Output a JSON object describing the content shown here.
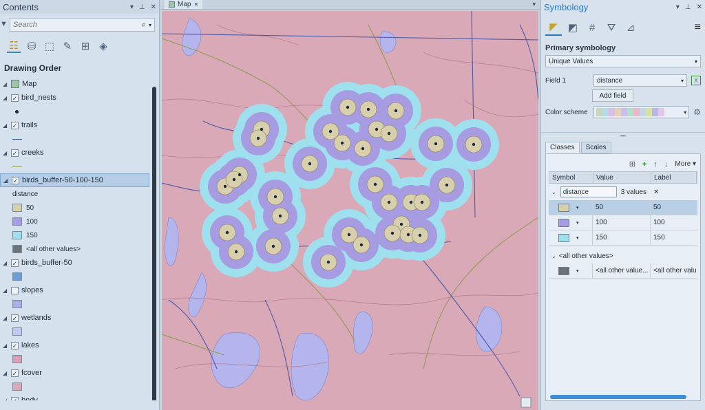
{
  "contents": {
    "title": "Contents",
    "search_placeholder": "Search",
    "drawing_order": "Drawing Order",
    "map_label": "Map",
    "layers": [
      {
        "name": "bird_nests",
        "checked": true
      },
      {
        "name": "trails",
        "checked": true
      },
      {
        "name": "creeks",
        "checked": true
      },
      {
        "name": "birds_buffer-50-100-150",
        "checked": true
      },
      {
        "name": "birds_buffer-50",
        "checked": true
      },
      {
        "name": "slopes",
        "checked": false
      },
      {
        "name": "wetlands",
        "checked": true
      },
      {
        "name": "lakes",
        "checked": true
      },
      {
        "name": "fcover",
        "checked": true
      },
      {
        "name": "bndy",
        "checked": true
      }
    ],
    "buffer_field": "distance",
    "buffer_classes": [
      {
        "label": "50",
        "color": "#d8cfad"
      },
      {
        "label": "100",
        "color": "#a79be2"
      },
      {
        "label": "150",
        "color": "#9fe0ee"
      },
      {
        "label": "<all other values>",
        "color": "#6a727b"
      }
    ]
  },
  "map": {
    "tab_label": "Map"
  },
  "symbology": {
    "title": "Symbology",
    "primary_label": "Primary symbology",
    "primary_value": "Unique Values",
    "field_label": "Field 1",
    "field_value": "distance",
    "add_field": "Add field",
    "scheme_label": "Color scheme",
    "tab_classes": "Classes",
    "tab_scales": "Scales",
    "more": "More",
    "col_symbol": "Symbol",
    "col_value": "Value",
    "col_label": "Label",
    "group_field": "distance",
    "group_count": "3 values",
    "rows": [
      {
        "value": "50",
        "label": "50",
        "color": "#d8cfad"
      },
      {
        "value": "100",
        "label": "100",
        "color": "#a79be2"
      },
      {
        "value": "150",
        "label": "150",
        "color": "#9fe0ee"
      }
    ],
    "other_header": "<all other values>",
    "other_row": {
      "value": "<all other value...",
      "label": "<all other valu",
      "color": "#6a727b"
    }
  },
  "colors": {
    "land": "#d9a9b8",
    "lakes": "#b3b5ec",
    "buffer50": "#d8cfad",
    "buffer100": "#a79be2",
    "buffer150": "#9fe0ee"
  }
}
